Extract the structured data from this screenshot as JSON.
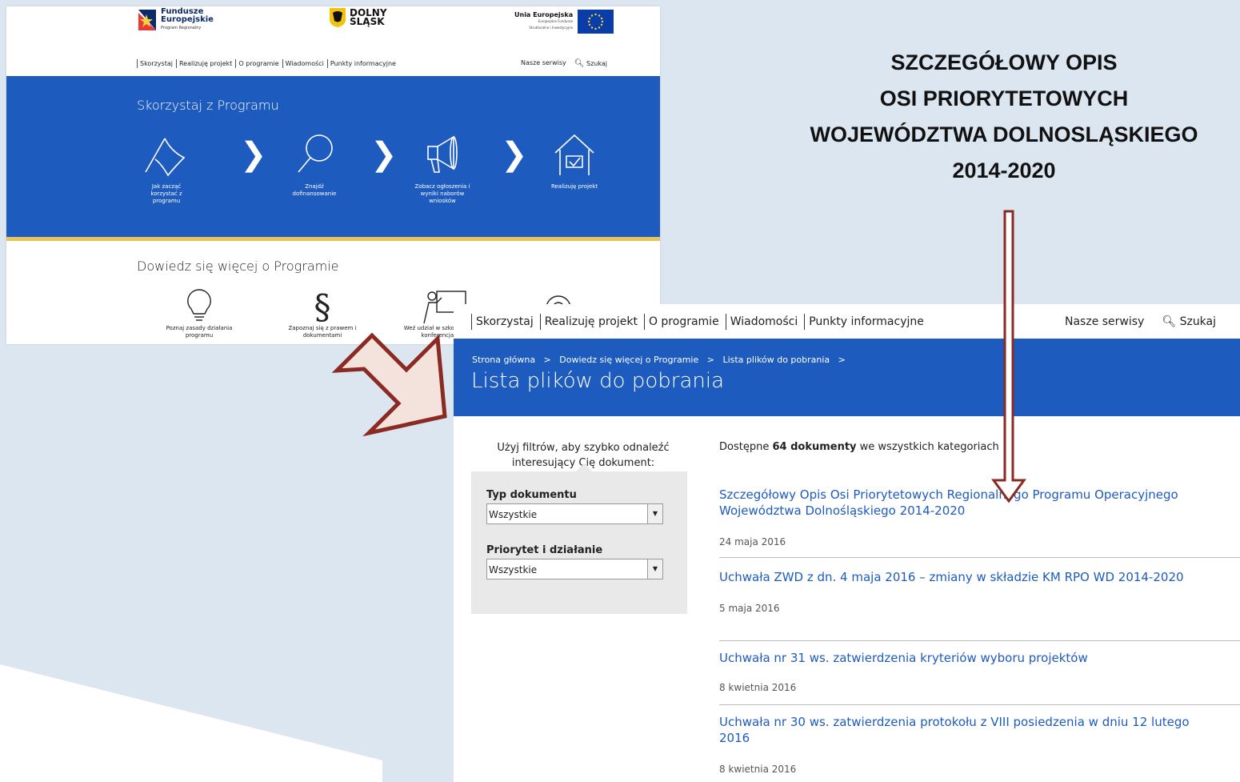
{
  "heading": {
    "line1": "SZCZEGÓŁOWY OPIS",
    "line2": "OSI PRIORYTETOWYCH",
    "line3": "WOJEWÓDZTWA DOLNOSLĄSKIEGO",
    "line4": "2014-2020"
  },
  "shot1": {
    "logos": {
      "fe_line1": "Fundusze",
      "fe_line2": "Europejskie",
      "fe_line3": "Program Regionalny",
      "ds_line1": "DOLNY",
      "ds_line2": "ŚLĄSK",
      "ue_line1": "Unia Europejska",
      "ue_line2": "Europejskie Fundusze",
      "ue_line3": "Strukturalne i Inwestycyjne"
    },
    "nav": [
      "Skorzystaj",
      "Realizuję projekt",
      "O programie",
      "Wiadomości",
      "Punkty informacyjne"
    ],
    "nav_right": [
      "Nasze serwisy",
      "Szukaj"
    ],
    "hero_title": "Skorzystaj z Programu",
    "steps": [
      {
        "label": "Jak zacząć korzystać z programu",
        "icon": "flag-icon"
      },
      {
        "label": "Znajdź dofinansowanie",
        "icon": "magnifier-icon"
      },
      {
        "label": "Zobacz ogłoszenia i wyniki naborów wniosków",
        "icon": "megaphone-icon"
      },
      {
        "label": "Realizuję projekt",
        "icon": "house-check-icon"
      }
    ],
    "more_title": "Dowiedz się więcej o Programie",
    "more_items": [
      {
        "label": "Poznaj zasady działania programu",
        "icon": "lightbulb-icon"
      },
      {
        "label": "Zapoznaj się z prawem i dokumentami",
        "icon": "paragraph-icon"
      },
      {
        "label": "Weź udział w szkoleniach i konferencjach",
        "icon": "presenter-icon"
      }
    ]
  },
  "shot2": {
    "nav": [
      "Skorzystaj",
      "Realizuję projekt",
      "O programie",
      "Wiadomości",
      "Punkty informacyjne"
    ],
    "nav_right": [
      "Nasze serwisy",
      "Szukaj"
    ],
    "breadcrumb": [
      "Strona główna",
      "Dowiedz się więcej o Programie",
      "Lista plików do pobrania"
    ],
    "page_title": "Lista plików do pobrania",
    "filter_intro": "Użyj filtrów, aby szybko odnaleźć interesujący Cię dokument:",
    "filters": [
      {
        "label": "Typ dokumentu",
        "value": "Wszystkie"
      },
      {
        "label": "Priorytet i działanie",
        "value": "Wszystkie"
      }
    ],
    "available_prefix": "Dostępne ",
    "available_count": "64 dokumenty",
    "available_suffix": " we wszystkich kategoriach",
    "documents": [
      {
        "title": "Szczegółowy Opis Osi Priorytetowych Regionalnego Programu Operacyjnego Województwa Dolnośląskiego 2014-2020",
        "date": "24 maja 2016"
      },
      {
        "title": "Uchwała ZWD z dn. 4 maja 2016 – zmiany w składzie KM RPO WD 2014-2020",
        "date": "5 maja 2016"
      },
      {
        "title": "Uchwała nr 31 ws. zatwierdzenia kryteriów wyboru projektów",
        "date": "8 kwietnia 2016"
      },
      {
        "title": "Uchwała nr 30 ws. zatwierdzenia protokołu z VIII posiedzenia w dniu 12 lutego 2016",
        "date": "8 kwietnia 2016"
      }
    ]
  },
  "colors": {
    "brand_blue": "#1d5bbf",
    "gold_stripe": "#e6c65b",
    "arrow_fill": "#f3e3dc",
    "arrow_stroke": "#8b2a23"
  }
}
